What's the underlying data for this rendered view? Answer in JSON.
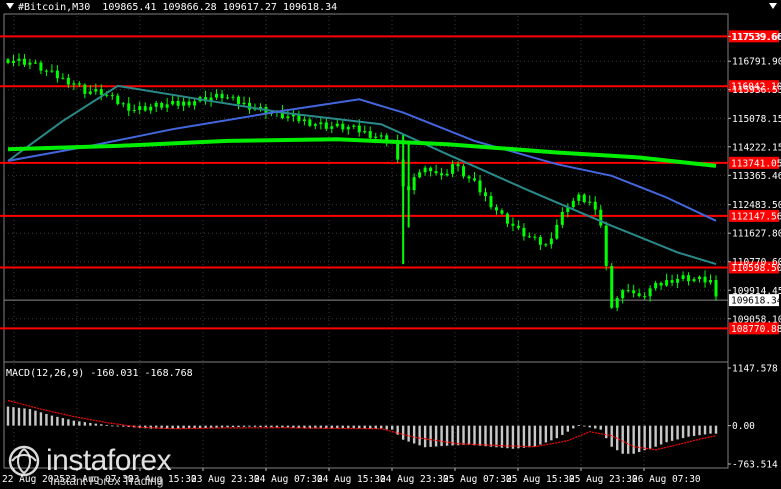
{
  "header": {
    "symbol": "#Bitcoin,M30",
    "open": "109865.41",
    "high": "109866.28",
    "low": "109617.27",
    "close": "109618.34"
  },
  "macd_header": {
    "label": "MACD(12,26,9)",
    "main": "-160.031",
    "signal": "-168.768"
  },
  "logo": {
    "brand": "instaforex",
    "tagline": "Instant Forex Trading"
  },
  "colors": {
    "background": "#000000",
    "candle": "#00ff00",
    "level": "#ff0000",
    "ma_fast": "#2a8a8a",
    "ma_mid": "#4466dd",
    "ma_slow": "#00ee00",
    "macd_hist": "#c8c8c8",
    "macd_signal": "#ff0000"
  },
  "chart_data": {
    "type": "candlestick",
    "title": "#Bitcoin,M30",
    "price_range": [
      107820,
      118150
    ],
    "price_ticks": [
      "117539.66",
      "116791.90",
      "115936.53",
      "115078.15",
      "114222.15",
      "113365.46",
      "112483.50",
      "111627.80",
      "110770.60",
      "109914.45",
      "109058.10"
    ],
    "levels": [
      {
        "value": 117539.66,
        "label": "117539.66"
      },
      {
        "value": 116042.1,
        "label": "116042.10"
      },
      {
        "value": 113741.05,
        "label": "113741.05"
      },
      {
        "value": 112147.56,
        "label": "112147.56"
      },
      {
        "value": 110598.5,
        "label": "110598.50"
      },
      {
        "value": 108770.88,
        "label": "108770.88"
      }
    ],
    "current_price": {
      "value": 109618.34,
      "label": "109618.34"
    },
    "time_labels": [
      "22 Aug 2025",
      "23 Aug 07:30",
      "23 Aug 15:30",
      "23 Aug 23:30",
      "24 Aug 07:30",
      "24 Aug 15:30",
      "24 Aug 23:30",
      "25 Aug 07:30",
      "25 Aug 15:30",
      "25 Aug 23:30",
      "26 Aug 07:30"
    ],
    "close_path": [
      [
        0,
        116850
      ],
      [
        4,
        116750
      ],
      [
        8,
        116400
      ],
      [
        10,
        116250
      ],
      [
        12,
        116150
      ],
      [
        14,
        115900
      ],
      [
        17,
        115850
      ],
      [
        20,
        115550
      ],
      [
        23,
        115350
      ],
      [
        27,
        115450
      ],
      [
        31,
        115500
      ],
      [
        35,
        115650
      ],
      [
        39,
        115750
      ],
      [
        42,
        115550
      ],
      [
        46,
        115350
      ],
      [
        50,
        115150
      ],
      [
        54,
        115000
      ],
      [
        58,
        114850
      ],
      [
        62,
        114800
      ],
      [
        66,
        114600
      ],
      [
        70,
        114400
      ],
      [
        72,
        113100
      ],
      [
        73,
        112900
      ],
      [
        75,
        113500
      ],
      [
        77,
        113600
      ],
      [
        79,
        113300
      ],
      [
        81,
        113700
      ],
      [
        83,
        113400
      ],
      [
        85,
        113100
      ],
      [
        87,
        112700
      ],
      [
        90,
        112150
      ],
      [
        93,
        111700
      ],
      [
        96,
        111400
      ],
      [
        98,
        111250
      ],
      [
        100,
        111900
      ],
      [
        102,
        112500
      ],
      [
        104,
        112700
      ],
      [
        106,
        112550
      ],
      [
        108,
        111900
      ],
      [
        109,
        110600
      ],
      [
        110,
        109500
      ],
      [
        111,
        109700
      ],
      [
        113,
        110000
      ],
      [
        115,
        109650
      ],
      [
        117,
        109950
      ],
      [
        119,
        110100
      ],
      [
        121,
        110250
      ],
      [
        123,
        110300
      ],
      [
        125,
        110250
      ],
      [
        128,
        110200
      ],
      [
        129,
        109618.34
      ]
    ],
    "moving_averages": [
      {
        "color": "#2a8a8a",
        "points": [
          [
            0,
            113800
          ],
          [
            10,
            115000
          ],
          [
            20,
            116050
          ],
          [
            35,
            115650
          ],
          [
            50,
            115250
          ],
          [
            68,
            114900
          ],
          [
            80,
            114000
          ],
          [
            95,
            112900
          ],
          [
            110,
            111850
          ],
          [
            122,
            111050
          ],
          [
            129,
            110700
          ]
        ]
      },
      {
        "color": "#4466dd",
        "points": [
          [
            0,
            113800
          ],
          [
            15,
            114250
          ],
          [
            30,
            114750
          ],
          [
            50,
            115300
          ],
          [
            64,
            115650
          ],
          [
            72,
            115250
          ],
          [
            85,
            114400
          ],
          [
            100,
            113700
          ],
          [
            110,
            113350
          ],
          [
            120,
            112700
          ],
          [
            129,
            112000
          ]
        ]
      },
      {
        "color": "#00ee00",
        "points": [
          [
            0,
            114150
          ],
          [
            20,
            114250
          ],
          [
            40,
            114400
          ],
          [
            60,
            114450
          ],
          [
            80,
            114300
          ],
          [
            100,
            114050
          ],
          [
            115,
            113900
          ],
          [
            129,
            113650
          ]
        ]
      }
    ],
    "macd": {
      "ticks": [
        "1147.578",
        "0.00",
        "-763.514"
      ],
      "range": [
        -763.514,
        1147.578
      ],
      "histogram": [
        [
          0,
          380
        ],
        [
          4,
          330
        ],
        [
          8,
          200
        ],
        [
          12,
          100
        ],
        [
          16,
          40
        ],
        [
          20,
          -10
        ],
        [
          26,
          -60
        ],
        [
          32,
          -60
        ],
        [
          38,
          -40
        ],
        [
          44,
          -20
        ],
        [
          50,
          -40
        ],
        [
          56,
          -60
        ],
        [
          62,
          -50
        ],
        [
          66,
          -60
        ],
        [
          70,
          -80
        ],
        [
          72,
          -280
        ],
        [
          76,
          -430
        ],
        [
          80,
          -400
        ],
        [
          84,
          -380
        ],
        [
          88,
          -420
        ],
        [
          92,
          -460
        ],
        [
          96,
          -420
        ],
        [
          100,
          -250
        ],
        [
          104,
          10
        ],
        [
          108,
          -80
        ],
        [
          110,
          -420
        ],
        [
          112,
          -560
        ],
        [
          114,
          -560
        ],
        [
          116,
          -490
        ],
        [
          118,
          -420
        ],
        [
          120,
          -330
        ],
        [
          124,
          -220
        ],
        [
          128,
          -160
        ]
      ],
      "signal": [
        [
          0,
          500
        ],
        [
          6,
          330
        ],
        [
          12,
          180
        ],
        [
          18,
          60
        ],
        [
          24,
          -30
        ],
        [
          30,
          -60
        ],
        [
          40,
          -45
        ],
        [
          50,
          -40
        ],
        [
          60,
          -55
        ],
        [
          68,
          -60
        ],
        [
          74,
          -230
        ],
        [
          82,
          -360
        ],
        [
          90,
          -400
        ],
        [
          96,
          -420
        ],
        [
          102,
          -300
        ],
        [
          106,
          -120
        ],
        [
          110,
          -200
        ],
        [
          114,
          -420
        ],
        [
          118,
          -480
        ],
        [
          122,
          -380
        ],
        [
          126,
          -270
        ],
        [
          129,
          -200
        ]
      ]
    }
  }
}
